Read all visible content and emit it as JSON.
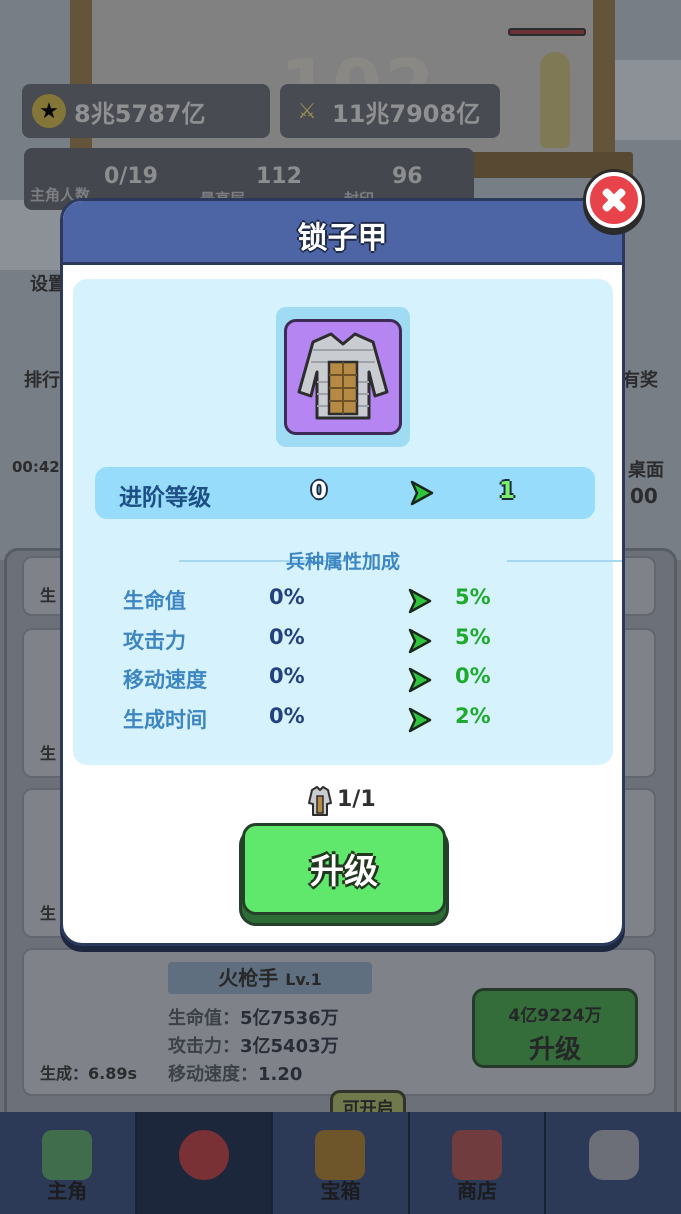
{
  "background": {
    "tower_floor_number": "102",
    "resources": {
      "gold": "8兆5787亿",
      "attack_power": "11兆7908亿"
    },
    "stats": {
      "heroes_value": "0/19",
      "heroes_label": "主角人数",
      "highest_floor_value": "112",
      "highest_floor_label": "最高层",
      "gems_value": "96",
      "gems_label": "封印"
    },
    "side_left": {
      "settings": "设置",
      "ranking": "排行",
      "timer": "00:42"
    },
    "side_right": {
      "reward": "有奖",
      "desktop": "桌面",
      "desktop_count": "00"
    },
    "list_labels": {
      "gen1": "生",
      "gen2": "生",
      "gen3": "生"
    },
    "unit_card": {
      "name": "火枪手",
      "level": "Lv.1",
      "hp_label": "生命值：",
      "hp_value": "5亿7536万",
      "atk_label": "攻击力：",
      "atk_value": "3亿5403万",
      "speed_label": "移动速度：",
      "speed_value": "1.20",
      "gen_time_label": "生成：",
      "gen_time_value": "6.89s",
      "upgrade_cost": "4亿9224万",
      "upgrade_label": "升级"
    },
    "unlock_badge": "可开启",
    "nav": {
      "tabs": [
        {
          "label": "主角",
          "selected": false
        },
        {
          "label": "",
          "selected": true
        },
        {
          "label": "宝箱",
          "selected": false
        },
        {
          "label": "商店",
          "selected": false
        },
        {
          "label": "",
          "selected": false
        }
      ]
    }
  },
  "modal": {
    "title": "锁子甲",
    "item_icon": "chainmail-armor-icon",
    "rank": {
      "label": "进阶等级",
      "from": "0",
      "to": "1"
    },
    "section_title": "兵种属性加成",
    "attributes": [
      {
        "name": "生命值",
        "from": "0%",
        "to": "5%"
      },
      {
        "name": "攻击力",
        "from": "0%",
        "to": "5%"
      },
      {
        "name": "移动速度",
        "from": "0%",
        "to": "0%"
      },
      {
        "name": "生成时间",
        "from": "0%",
        "to": "2%"
      }
    ],
    "item_count": "1/1",
    "upgrade_button": "升级"
  },
  "colors": {
    "modal_header": "#4d65a5",
    "info_box": "#d6f3fd",
    "rank_bar": "#97ddfb",
    "upgrade_green": "#5fe86c",
    "close_red": "#e8434a",
    "bonus_green": "#1eaa2c"
  }
}
